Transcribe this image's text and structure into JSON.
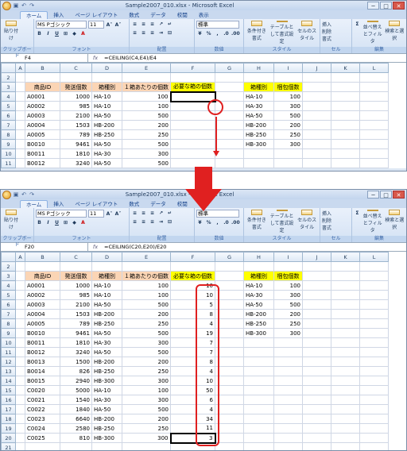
{
  "window1": {
    "title": "Sample2007_010.xlsx - Microsoft Excel",
    "namebox": "F4",
    "formula": "=CEILING(C4,E4)/E4"
  },
  "window2": {
    "title": "Sample2007_010.xlsx - Microsoft Excel",
    "namebox": "F20",
    "formula": "=CEILING(C20,E20)/E20"
  },
  "tabs": [
    "ホーム",
    "挿入",
    "ページ レイアウト",
    "数式",
    "データ",
    "校閲",
    "表示"
  ],
  "ribbon": {
    "paste": "貼り付け",
    "font_name": "MS Pゴシック",
    "font_size": "11",
    "number_format": "標準",
    "cond_format": "条件付き書式",
    "table_format": "テーブルとして書式設定",
    "cell_style": "セルのスタイル",
    "insert": "挿入",
    "delete": "削除",
    "format": "書式",
    "sort_filter": "並べ替えとフィルタ",
    "find_select": "検索と選択",
    "group_clipboard": "クリップボード",
    "group_font": "フォント",
    "group_align": "配置",
    "group_number": "数値",
    "group_style": "スタイル",
    "group_cells": "セル",
    "group_edit": "編集"
  },
  "columns": [
    "A",
    "B",
    "C",
    "D",
    "E",
    "F",
    "G",
    "H",
    "I",
    "J",
    "K",
    "L"
  ],
  "headers": {
    "id": "商品ID",
    "qty": "発送個数",
    "box": "箱種別",
    "per_box": "１箱あたりの個数",
    "needed": "必要な箱の個数",
    "box_type": "箱種別",
    "pack_qty": "梱包個数"
  },
  "rows": [
    [
      "A0001",
      "1000",
      "HA-10",
      "100",
      "10"
    ],
    [
      "A0002",
      "985",
      "HA-10",
      "100",
      "10"
    ],
    [
      "A0003",
      "2100",
      "HA-50",
      "500",
      "5"
    ],
    [
      "A0004",
      "1503",
      "HB-200",
      "200",
      "8"
    ],
    [
      "A0005",
      "789",
      "HB-250",
      "250",
      "4"
    ],
    [
      "B0010",
      "9461",
      "HA-50",
      "500",
      "19"
    ],
    [
      "B0011",
      "1810",
      "HA-30",
      "300",
      "7"
    ],
    [
      "B0012",
      "3240",
      "HA-50",
      "500",
      "7"
    ],
    [
      "B0013",
      "1500",
      "HB-200",
      "200",
      "8"
    ],
    [
      "B0014",
      "826",
      "HB-250",
      "250",
      "4"
    ],
    [
      "B0015",
      "2940",
      "HB-300",
      "300",
      "10"
    ],
    [
      "C0020",
      "5000",
      "HA-10",
      "100",
      "50"
    ],
    [
      "C0021",
      "1540",
      "HA-30",
      "300",
      "6"
    ],
    [
      "C0022",
      "1840",
      "HA-50",
      "500",
      "4"
    ],
    [
      "C0023",
      "6640",
      "HB-200",
      "200",
      "34"
    ],
    [
      "C0024",
      "2580",
      "HB-250",
      "250",
      "11"
    ],
    [
      "C0025",
      "810",
      "HB-300",
      "300",
      "3"
    ]
  ],
  "lookup": [
    [
      "HA-10",
      "100"
    ],
    [
      "HA-30",
      "300"
    ],
    [
      "HA-50",
      "500"
    ],
    [
      "HB-200",
      "200"
    ],
    [
      "HB-250",
      "250"
    ],
    [
      "HB-300",
      "300"
    ]
  ],
  "colors": {
    "header_orange": "#fbd5b5",
    "header_yellow": "#ffff00",
    "header_green": "#b7e1a0",
    "annotation_red": "#e02020"
  }
}
